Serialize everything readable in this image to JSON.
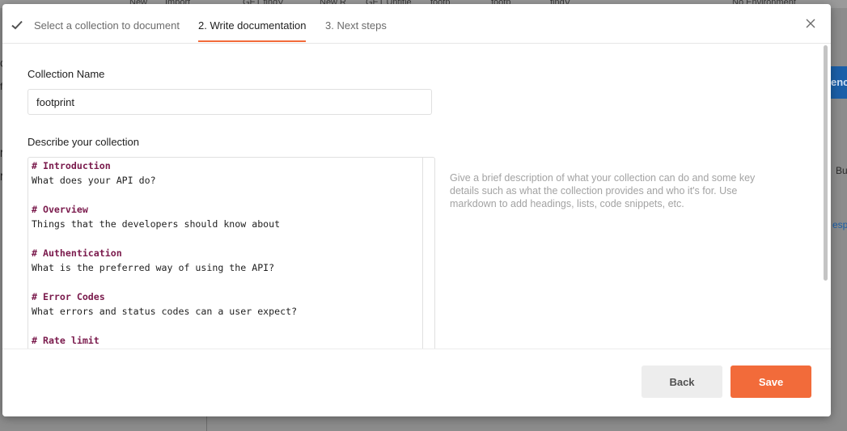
{
  "background": {
    "tabs": [
      "New",
      "Import",
      "GET findV",
      "New R",
      "GET Untitle",
      "footp",
      "footp",
      "findV",
      "No Environment"
    ],
    "sidebar_fragments": [
      "C",
      "f",
      "N",
      "N"
    ],
    "send_fragment": "enc",
    "right_fragments": [
      "Bu",
      "esp"
    ]
  },
  "wizard": {
    "steps": [
      {
        "label": "Select a collection to document",
        "state": "complete"
      },
      {
        "label": "2. Write documentation",
        "state": "active"
      },
      {
        "label": "3. Next steps",
        "state": "pending"
      }
    ]
  },
  "form": {
    "name_label": "Collection Name",
    "name_value": "footprint",
    "describe_label": "Describe your collection",
    "description_lines": [
      {
        "text": "# Introduction",
        "heading": true
      },
      {
        "text": "What does your API do?",
        "heading": false
      },
      {
        "text": "",
        "heading": false
      },
      {
        "text": "# Overview",
        "heading": true
      },
      {
        "text": "Things that the developers should know about",
        "heading": false
      },
      {
        "text": "",
        "heading": false
      },
      {
        "text": "# Authentication",
        "heading": true
      },
      {
        "text": "What is the preferred way of using the API?",
        "heading": false
      },
      {
        "text": "",
        "heading": false
      },
      {
        "text": "# Error Codes",
        "heading": true
      },
      {
        "text": "What errors and status codes can a user expect?",
        "heading": false
      },
      {
        "text": "",
        "heading": false
      },
      {
        "text": "# Rate limit",
        "heading": true
      }
    ],
    "hint": "Give a brief description of what your collection can do and some key details such as what the collection provides and who it's for. Use markdown to add headings, lists, code snippets, etc."
  },
  "footer": {
    "back_label": "Back",
    "save_label": "Save"
  },
  "colors": {
    "accent": "#f26b3a",
    "heading_text": "#7a1a4c",
    "hint_text": "#a3a3a3"
  },
  "icons": {
    "step_complete": "check-icon",
    "close": "close-icon"
  }
}
